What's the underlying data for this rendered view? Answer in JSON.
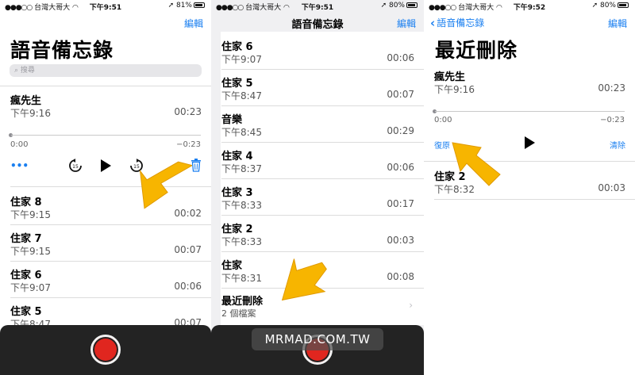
{
  "status": {
    "carrier": "台灣大哥大",
    "time1": "下午9:51",
    "time2": "下午9:51",
    "time3": "下午9:52",
    "battery1": "81%",
    "battery2": "80%",
    "battery3": "80%"
  },
  "panel1": {
    "edit_label": "編輯",
    "title": "語音備忘錄",
    "search_placeholder": "搜尋",
    "expanded": {
      "name": "瘋先生",
      "time": "下午9:16",
      "duration": "00:23",
      "elapsed": "0:00",
      "remaining": "−0:23",
      "more_label": "•••"
    },
    "recordings": [
      {
        "name": "住家 8",
        "time": "下午9:15",
        "duration": "00:02"
      },
      {
        "name": "住家 7",
        "time": "下午9:15",
        "duration": "00:07"
      },
      {
        "name": "住家 6",
        "time": "下午9:07",
        "duration": "00:06"
      },
      {
        "name": "住家 5",
        "time": "下午8:47",
        "duration": "00:07"
      }
    ]
  },
  "panel2": {
    "nav_title": "語音備忘錄",
    "edit_label": "編輯",
    "recordings": [
      {
        "name": "住家 6",
        "time": "下午9:07",
        "duration": "00:06"
      },
      {
        "name": "住家 5",
        "time": "下午8:47",
        "duration": "00:07"
      },
      {
        "name": "音樂",
        "time": "下午8:45",
        "duration": "00:29"
      },
      {
        "name": "住家 4",
        "time": "下午8:37",
        "duration": "00:06"
      },
      {
        "name": "住家 3",
        "time": "下午8:33",
        "duration": "00:17"
      },
      {
        "name": "住家 2",
        "time": "下午8:33",
        "duration": "00:03"
      },
      {
        "name": "住家",
        "time": "下午8:31",
        "duration": "00:08"
      }
    ],
    "recently_deleted": {
      "name": "最近刪除",
      "count": "2 個檔案"
    }
  },
  "panel3": {
    "back_label": "語音備忘錄",
    "edit_label": "編輯",
    "title": "最近刪除",
    "expanded": {
      "name": "瘋先生",
      "time": "下午9:16",
      "duration": "00:23",
      "elapsed": "0:00",
      "remaining": "−0:23",
      "recover_label": "復原",
      "clear_label": "清除"
    },
    "recordings": [
      {
        "name": "住家 2",
        "time": "下午8:32",
        "duration": "00:03"
      }
    ]
  },
  "watermark": "MRMAD.COM.TW",
  "colors": {
    "accent": "#1a7ff0",
    "record": "#e0261f",
    "arrow": "#f7b500",
    "recbar": "#232323"
  }
}
